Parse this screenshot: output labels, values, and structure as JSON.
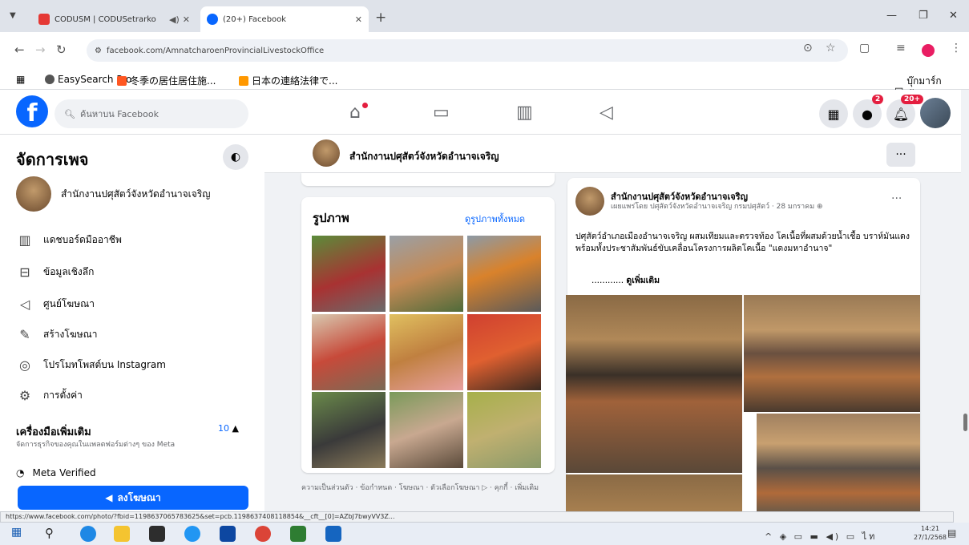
{
  "browser": {
    "tabs": [
      {
        "title": "CODUSM | CODUSetrarko",
        "active": false
      },
      {
        "title": "(20+) Facebook",
        "active": true
      }
    ],
    "url": "facebook.com/AmnatcharoenProvincialLivestockOffice",
    "bookmarks": [
      "EasySearch Pro",
      "冬季の居住居住施...",
      "日本の連絡法律で..."
    ],
    "bookmarks_right": "บุ๊กมาร์กทั้งหมด"
  },
  "fb": {
    "search_placeholder": "ค้นหาบน Facebook",
    "messenger_badge": "2",
    "notif_badge": "20+"
  },
  "sidebar": {
    "title": "จัดการเพจ",
    "page_name": "สำนักงานปศุสัตว์จังหวัดอำนาจเจริญ",
    "items": [
      {
        "icon": "dashboard-icon",
        "label": "แดชบอร์ดมืออาชีพ"
      },
      {
        "icon": "insights-icon",
        "label": "ข้อมูลเชิงลึก"
      },
      {
        "icon": "megaphone-icon",
        "label": "ศูนย์โฆษณา"
      },
      {
        "icon": "edit-icon",
        "label": "สร้างโฆษณา"
      },
      {
        "icon": "instagram-icon",
        "label": "โปรโมทโพสต์บน Instagram"
      },
      {
        "icon": "gear-icon",
        "label": "การตั้งค่า"
      }
    ],
    "tools_title": "เครื่องมือเพิ่มเติม",
    "tools_sub": "จัดการธุรกิจของคุณในแพลตฟอร์มต่างๆ ของ Meta",
    "tools_count": "10",
    "partial_item": "Meta Verified",
    "cta": "ลงโฆษณา"
  },
  "page_header": {
    "name": "สำนักงานปศุสัตว์จังหวัดอำนาจเจริญ"
  },
  "photos": {
    "title": "รูปภาพ",
    "see_all": "ดูรูปภาพทั้งหมด",
    "footer": "ความเป็นส่วนตัว · ข้อกำหนด · โฆษณา · ตัวเลือกโฆษณา ▷ · คุกกี้ · เพิ่มเติม"
  },
  "post": {
    "author": "สำนักงานปศุสัตว์จังหวัดอำนาจเจริญ",
    "meta": "เผยแพร่โดย ปศุสัตว์จังหวัดอำนาจเจริญ กรมปศุสัตว์ · 28 มกราคม",
    "text": "ปศุสัตว์อำเภอเมืองอำนาจเจริญ ผสมเทียมและตรวจท้อง โคเนื้อที่ผสมด้วยน้ำเชื้อ บราห์มันแดง พร้อมทั้งประชาสัมพันธ์ขับเคลื่อนโครงการผลิตโคเนื้อ \"แดงมหาอำนาจ\"",
    "see_more_prefix": "............",
    "see_more": "ดูเพิ่มเติม"
  },
  "status_url": "https://www.facebook.com/photo/?fbid=1198637065783625&set=pcb.1198637408118854&__cft__[0]=AZbJ7bwyVV3Z...",
  "clock": {
    "time": "14:21",
    "date": "27/1/2568"
  }
}
